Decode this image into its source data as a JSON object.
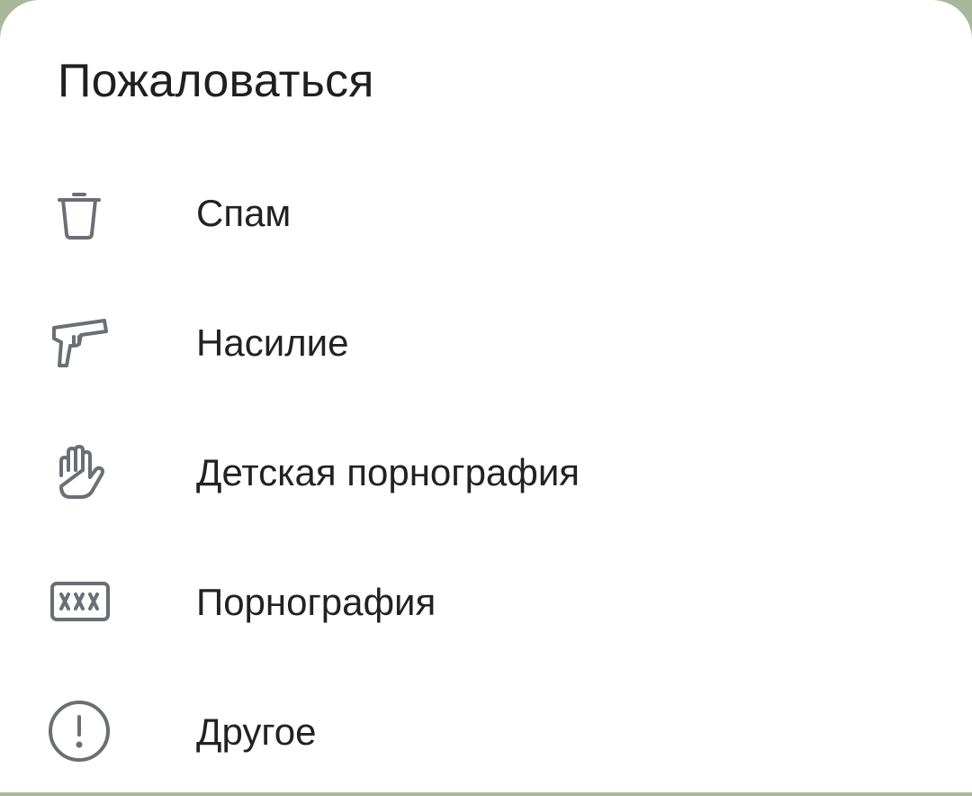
{
  "dialog": {
    "title": "Пожаловаться",
    "items": [
      {
        "label": "Спам",
        "icon": "trash-icon"
      },
      {
        "label": "Насилие",
        "icon": "pistol-icon"
      },
      {
        "label": "Детская порнография",
        "icon": "hand-icon"
      },
      {
        "label": "Порнография",
        "icon": "xxx-icon"
      },
      {
        "label": "Другое",
        "icon": "exclamation-circle-icon"
      }
    ]
  },
  "colors": {
    "background": "#a9b79a",
    "sheet": "#ffffff",
    "text": "#222222",
    "icon": "#6b6f75"
  }
}
